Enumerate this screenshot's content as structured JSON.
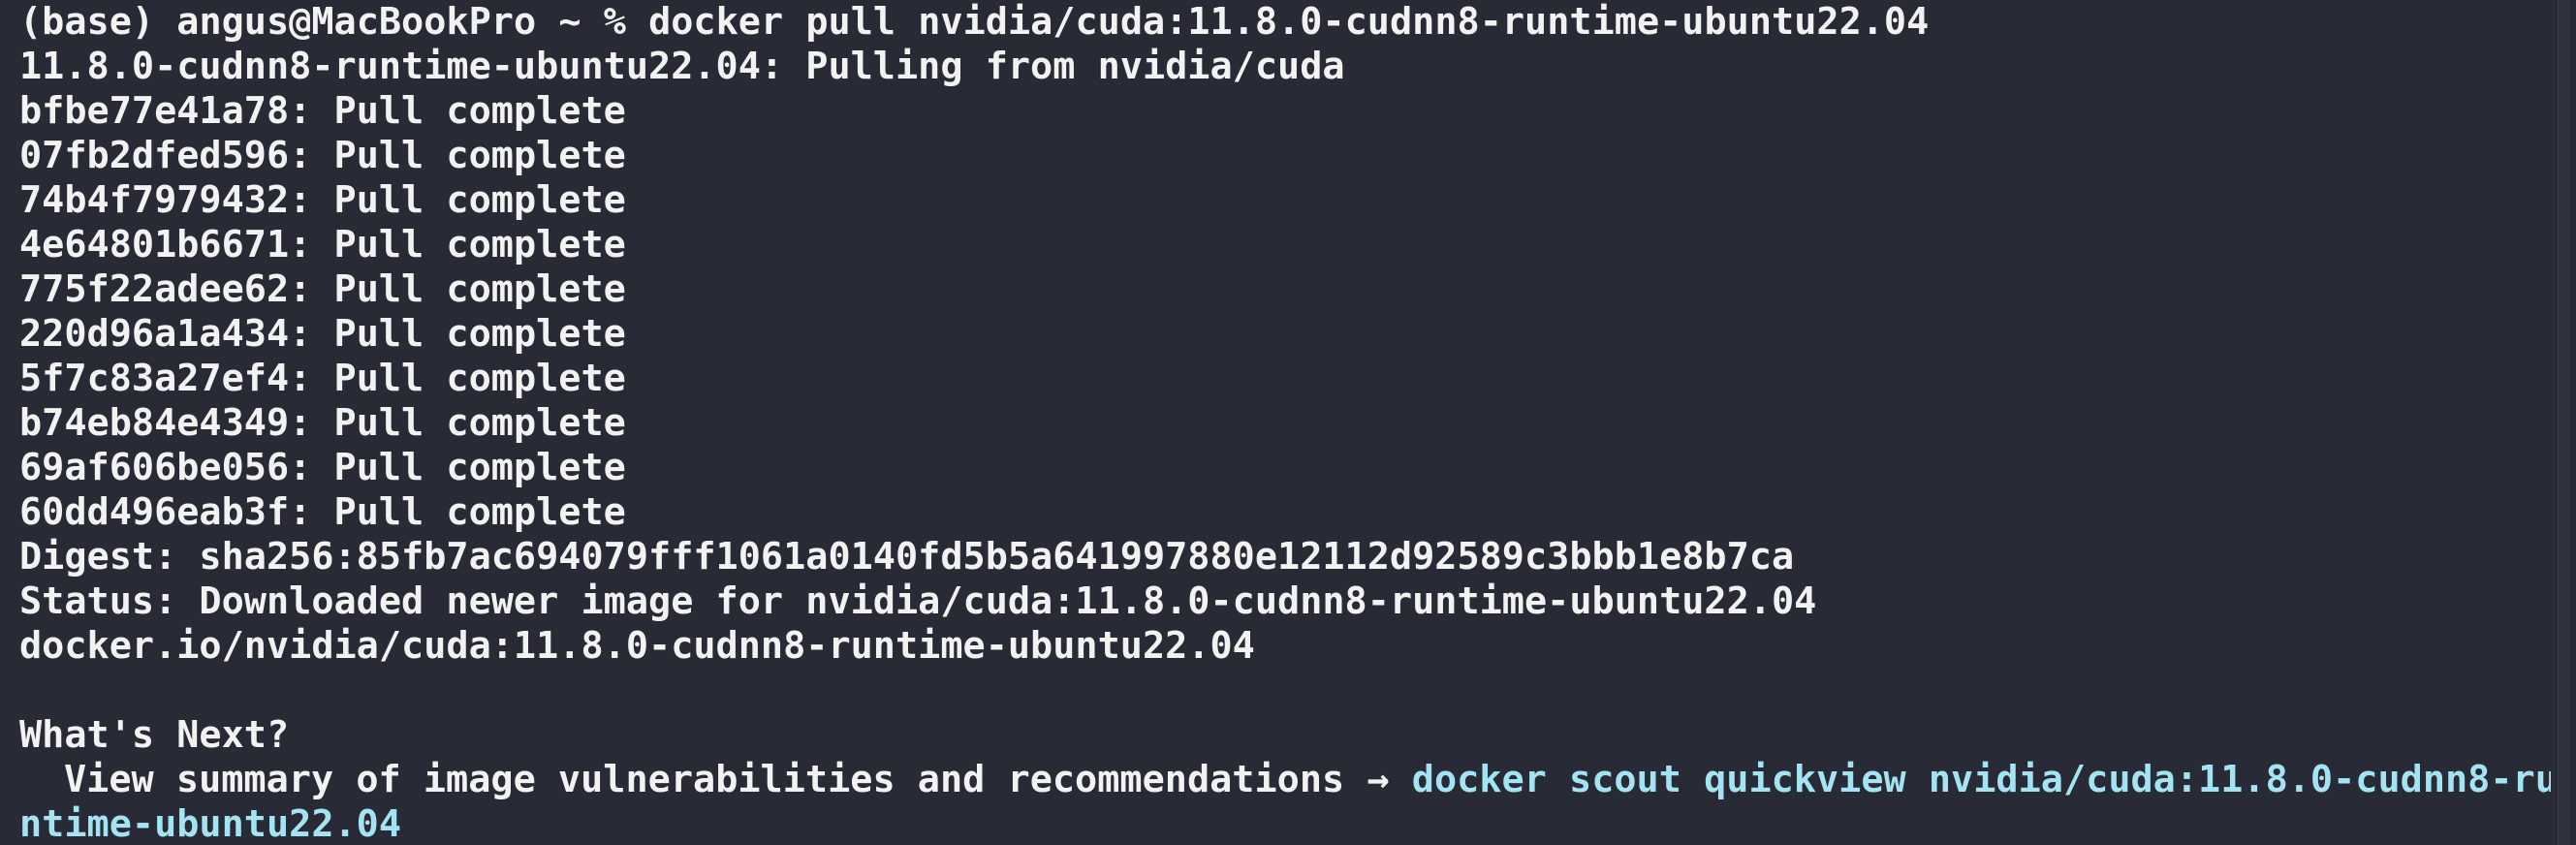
{
  "terminal": {
    "prompt": {
      "env": "(base)",
      "user_host": "angus@MacBookPro",
      "cwd": "~",
      "symbol": "%",
      "command": "docker pull nvidia/cuda:11.8.0-cudnn8-runtime-ubuntu22.04"
    },
    "pulling_line": "11.8.0-cudnn8-runtime-ubuntu22.04: Pulling from nvidia/cuda",
    "layers": [
      {
        "id": "bfbe77e41a78",
        "status": "Pull complete"
      },
      {
        "id": "07fb2dfed596",
        "status": "Pull complete"
      },
      {
        "id": "74b4f7979432",
        "status": "Pull complete"
      },
      {
        "id": "4e64801b6671",
        "status": "Pull complete"
      },
      {
        "id": "775f22adee62",
        "status": "Pull complete"
      },
      {
        "id": "220d96a1a434",
        "status": "Pull complete"
      },
      {
        "id": "5f7c83a27ef4",
        "status": "Pull complete"
      },
      {
        "id": "b74eb84e4349",
        "status": "Pull complete"
      },
      {
        "id": "69af606be056",
        "status": "Pull complete"
      },
      {
        "id": "60dd496eab3f",
        "status": "Pull complete"
      }
    ],
    "digest_line": "Digest: sha256:85fb7ac694079fff1061a0140fd5b5a641997880e12112d92589c3bbb1e8b7ca",
    "status_line": "Status: Downloaded newer image for nvidia/cuda:11.8.0-cudnn8-runtime-ubuntu22.04",
    "image_ref_line": "docker.io/nvidia/cuda:11.8.0-cudnn8-runtime-ubuntu22.04",
    "whats_next": {
      "heading": "What's Next?",
      "hint_text": "View summary of image vulnerabilities and recommendations",
      "arrow": "→",
      "command_part1": "docker scout quickview nvidia/cuda:11.8.0-cudnn8-ru",
      "command_part2": "ntime-ubuntu22.04"
    },
    "colors": {
      "background": "#282a36",
      "foreground": "#f2f2f2",
      "link": "#a4e3f2"
    }
  }
}
